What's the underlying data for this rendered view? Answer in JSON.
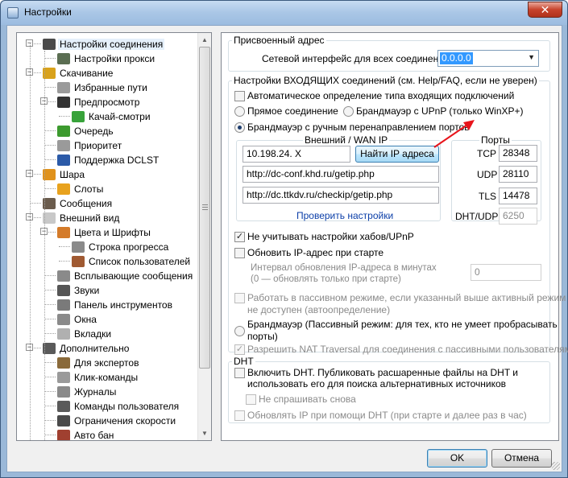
{
  "window": {
    "title": "Настройки",
    "close_label": "✕"
  },
  "tree": {
    "items": [
      {
        "label": "Настройки соединения",
        "level": 0,
        "icon": "network-icon",
        "color": "#4a4a4a",
        "expander": "−",
        "selected": true
      },
      {
        "label": "Настройки прокси",
        "level": 1,
        "icon": "proxy-icon",
        "color": "#5b6e52"
      },
      {
        "label": "Скачивание",
        "level": 0,
        "icon": "download-icon",
        "color": "#d9a21b",
        "expander": "−"
      },
      {
        "label": "Избранные пути",
        "level": 1,
        "icon": "folder-icon",
        "color": "#9a9a9a"
      },
      {
        "label": "Предпросмотр",
        "level": 1,
        "icon": "film-icon",
        "color": "#333333",
        "expander": "−"
      },
      {
        "label": "Качай-смотри",
        "level": 2,
        "icon": "arrow-icon",
        "color": "#38a33a"
      },
      {
        "label": "Очередь",
        "level": 1,
        "icon": "queue-icon",
        "color": "#3c9a2e"
      },
      {
        "label": "Приоритет",
        "level": 1,
        "icon": "priority-icon",
        "color": "#9a9a9a"
      },
      {
        "label": "Поддержка DCLST",
        "level": 1,
        "icon": "dclst-icon",
        "color": "#2b5aa8"
      },
      {
        "label": "Шара",
        "level": 0,
        "icon": "share-icon",
        "color": "#e0921c",
        "expander": "−"
      },
      {
        "label": "Слоты",
        "level": 1,
        "icon": "slots-icon",
        "color": "#e8a21e"
      },
      {
        "label": "Сообщения",
        "level": 0,
        "icon": "messages-icon",
        "color": "#6b5c4d"
      },
      {
        "label": "Внешний вид",
        "level": 0,
        "icon": "appearance-icon",
        "color": "#c8c8c8",
        "expander": "−"
      },
      {
        "label": "Цвета и Шрифты",
        "level": 1,
        "icon": "palette-icon",
        "color": "#d47b2a",
        "expander": "−"
      },
      {
        "label": "Строка прогресса",
        "level": 2,
        "icon": "progress-icon",
        "color": "#8a8a8a"
      },
      {
        "label": "Список пользователей",
        "level": 2,
        "icon": "userlist-icon",
        "color": "#a05a32"
      },
      {
        "label": "Всплывающие сообщения",
        "level": 1,
        "icon": "popup-icon",
        "color": "#8a8a8a"
      },
      {
        "label": "Звуки",
        "level": 1,
        "icon": "speaker-icon",
        "color": "#555555"
      },
      {
        "label": "Панель инструментов",
        "level": 1,
        "icon": "toolbar-icon",
        "color": "#7a7a7a"
      },
      {
        "label": "Окна",
        "level": 1,
        "icon": "windows-icon",
        "color": "#8a8a8a"
      },
      {
        "label": "Вкладки",
        "level": 1,
        "icon": "tabs-icon",
        "color": "#b0b0b0"
      },
      {
        "label": "Дополнительно",
        "level": 0,
        "icon": "tools-icon",
        "color": "#5a5a5a",
        "expander": "−"
      },
      {
        "label": "Для экспертов",
        "level": 1,
        "icon": "experts-icon",
        "color": "#8a6a3a"
      },
      {
        "label": "Клик-команды",
        "level": 1,
        "icon": "mouse-icon",
        "color": "#9a9a9a"
      },
      {
        "label": "Журналы",
        "level": 1,
        "icon": "logs-icon",
        "color": "#8a8a8a"
      },
      {
        "label": "Команды пользователя",
        "level": 1,
        "icon": "commands-icon",
        "color": "#5a5a5a"
      },
      {
        "label": "Ограничения скорости",
        "level": 1,
        "icon": "speedometer-icon",
        "color": "#4a4a4a"
      },
      {
        "label": "Авто бан",
        "level": 1,
        "icon": "ban-icon",
        "color": "#a04030"
      }
    ]
  },
  "assigned_address": {
    "legend": "Присвоенный адрес",
    "interface_label": "Сетевой интерфейс для всех соединений",
    "interface_value": "0.0.0.0"
  },
  "incoming": {
    "legend": "Настройки ВХОДЯЩИХ соединений (см. Help/FAQ, если не уверен)",
    "auto_detect_label": "Автоматическое определение типа входящих подключений",
    "direct_label": "Прямое соединение",
    "upnp_label": "Брандмауэр с UPnP (только WinXP+)",
    "manual_label": "Брандмауэр с ручным перенаправлением портов",
    "wan_legend": "Внешний / WAN IP",
    "ip_value": "10.198.24. X",
    "find_ip_button": "Найти IP адреса",
    "url1": "http://dc-conf.khd.ru/getip.php",
    "url2": "http://dc.ttkdv.ru/checkip/getip.php",
    "check_link": "Проверить настройки",
    "ports_legend": "Порты",
    "tcp_label": "TCP",
    "tcp_value": "28348",
    "udp_label": "UDP",
    "udp_value": "28110",
    "tls_label": "TLS",
    "tls_value": "14478",
    "dht_label": "DHT/UDP",
    "dht_value": "6250",
    "ignore_hubs_label": "Не учитывать настройки хабов/UPnP",
    "update_ip_label": "Обновить IP-адрес при старте",
    "interval_label_1": "Интервал обновления IP-адреса в минутах",
    "interval_label_2": "(0 — обновлять только при старте)",
    "interval_value": "0",
    "passive_label_1": "Работать в пассивном режиме, если указанный выше активный режим",
    "passive_label_2": "не доступен (автоопределение)",
    "passive_fw_label_1": "Брандмауэр (Пассивный режим: для тех, кто не умеет пробрасывать",
    "passive_fw_label_2": "порты)",
    "nat_label": "Разрешить NAT Traversal для соединения с пассивными пользователями"
  },
  "dht": {
    "legend": "DHT",
    "enable_label_1": "Включить DHT. Публиковать расшаренные файлы на DHT и",
    "enable_label_2": "использовать его для поиска альтернативных источников",
    "no_ask_label": "Не спрашивать снова",
    "update_label": "Обновлять IP при помощи DHT (при старте и далее раз в час)"
  },
  "footer": {
    "ok_label": "OK",
    "cancel_label": "Отмена"
  },
  "colors": {
    "accent_arrow": "#e8141b",
    "link": "#0b3ea8",
    "selection": "#3399ff"
  }
}
